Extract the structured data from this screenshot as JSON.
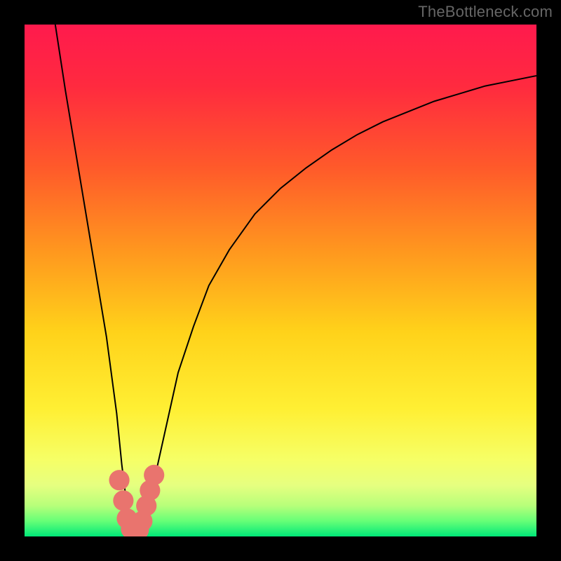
{
  "attribution": "TheBottleneck.com",
  "colors": {
    "frame": "#000000",
    "gradient_stops": [
      {
        "offset": 0.0,
        "color": "#ff1a4d"
      },
      {
        "offset": 0.12,
        "color": "#ff2a3f"
      },
      {
        "offset": 0.28,
        "color": "#ff5a2a"
      },
      {
        "offset": 0.45,
        "color": "#ff9a1e"
      },
      {
        "offset": 0.6,
        "color": "#ffd21a"
      },
      {
        "offset": 0.75,
        "color": "#ffef33"
      },
      {
        "offset": 0.85,
        "color": "#f6ff66"
      },
      {
        "offset": 0.9,
        "color": "#e6ff80"
      },
      {
        "offset": 0.94,
        "color": "#b7ff7a"
      },
      {
        "offset": 0.97,
        "color": "#66ff77"
      },
      {
        "offset": 1.0,
        "color": "#00e878"
      }
    ],
    "curve": "#000000",
    "markers": "#e9746e"
  },
  "chart_data": {
    "type": "line",
    "title": "",
    "xlabel": "",
    "ylabel": "",
    "xlim": [
      0,
      100
    ],
    "ylim": [
      0,
      100
    ],
    "series": [
      {
        "name": "bottleneck-curve",
        "x": [
          6,
          8,
          10,
          12,
          14,
          16,
          18,
          19,
          20,
          21,
          22,
          23,
          24,
          26,
          28,
          30,
          33,
          36,
          40,
          45,
          50,
          55,
          60,
          65,
          70,
          75,
          80,
          85,
          90,
          95,
          100
        ],
        "y": [
          100,
          87,
          75,
          63,
          51,
          39,
          24,
          14,
          6,
          1,
          0.5,
          1,
          5,
          14,
          23,
          32,
          41,
          49,
          56,
          63,
          68,
          72,
          75.5,
          78.5,
          81,
          83,
          85,
          86.5,
          88,
          89,
          90
        ]
      }
    ],
    "markers": {
      "name": "bottleneck-markers",
      "x": [
        18.5,
        19.3,
        20.0,
        20.8,
        21.5,
        22.3,
        23.0,
        23.8,
        24.5,
        25.3
      ],
      "y": [
        11,
        7,
        3.5,
        1.5,
        0.8,
        1.3,
        3.0,
        6.0,
        9.0,
        12.0
      ],
      "r": 2.0
    }
  }
}
